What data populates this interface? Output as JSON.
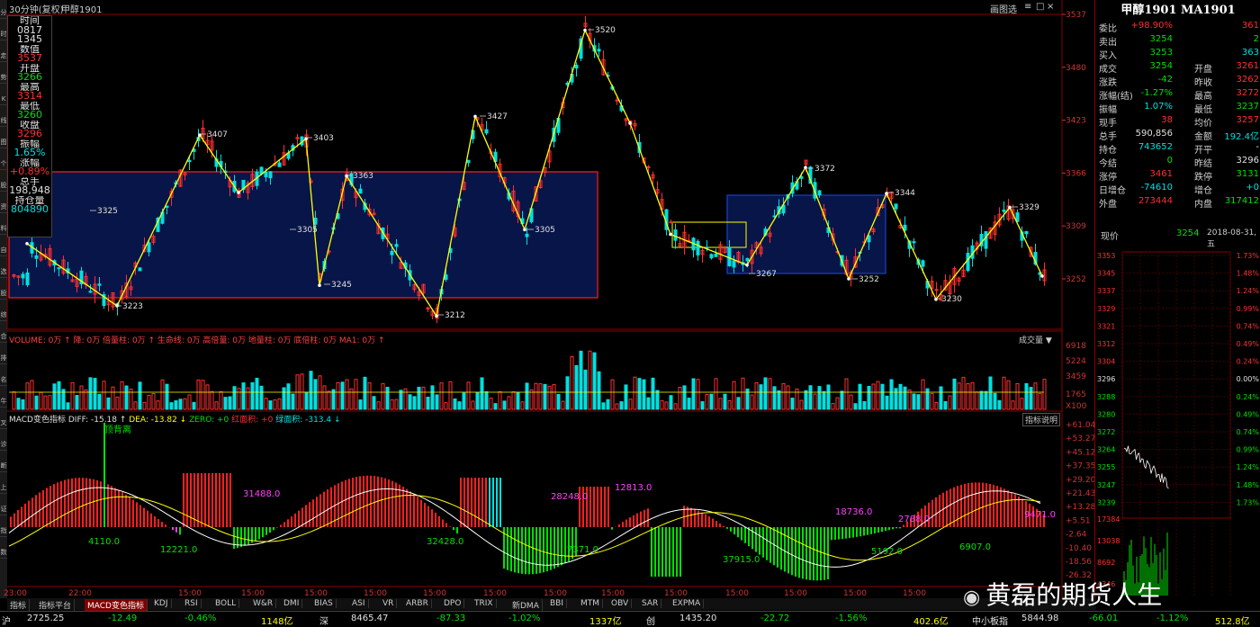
{
  "titlebar": {
    "period": "30分钟(复权)",
    "symbol": "甲醇1901",
    "btn_chart": "画图选",
    "btn_menu": "≡",
    "btn_min": "□",
    "btn_close": "×"
  },
  "leftstrip": [
    "分",
    "时",
    "走",
    "势",
    "K",
    "线",
    "图",
    "个",
    "股",
    "资",
    "料",
    "自",
    "选",
    "股",
    "综",
    "合",
    "排",
    "名",
    "牛",
    "叉",
    "诊",
    "断",
    "上",
    "证",
    "指",
    "数"
  ],
  "infobox": {
    "time_label": "时间",
    "time_value": "0817",
    "time_value2": "1345",
    "num_label": "数值",
    "num_value": "3537",
    "open_label": "开盘",
    "open_value": "3266",
    "high_label": "最高",
    "high_value": "3314",
    "low_label": "最低",
    "low_value": "3260",
    "close_label": "收盘",
    "close_value": "3296",
    "amp_label": "振幅",
    "amp_value": "1.65%",
    "chg_label": "涨幅",
    "chg_value": "+0.89%",
    "vol_label": "总手",
    "vol_value": "198,948",
    "oi_label": "持仓量",
    "oi_value": "804890"
  },
  "price_axis": [
    "3537",
    "3480",
    "3423",
    "3366",
    "3309",
    "3252"
  ],
  "volume_axis": [
    "6918",
    "5224",
    "3459",
    "1765",
    "X100"
  ],
  "macd_axis": [
    "61.04",
    "53.27",
    "45.12",
    "37.35",
    "29.20",
    "21.43",
    "13.28",
    "5.51",
    "-2.64",
    "-10.40",
    "-18.56",
    "-26.32"
  ],
  "volume_header": {
    "text": "VOLUME: 0万 ↑ 降: 0万 倍量柱: 0万 ↑ 生命线: 0万 高倍量: 0万 地量柱: 0万 底倍柱: 0万 MA1: 0万 ↑",
    "btn": "成交量 ▼"
  },
  "macd_header": {
    "name": "MACD变色指标",
    "diff": "DIFF: -15.18 ↑",
    "dea": "DEA: -13.82 ↓",
    "zero": "ZERO: +0",
    "redarea": "红面积: +0",
    "greenarea": "绿面积: -313.4 ↓",
    "btn": "指标说明"
  },
  "macd_labels": [
    {
      "text": "顶背离",
      "color": "#00e000"
    },
    {
      "text": "31488.0",
      "color": "#ff40ff"
    },
    {
      "text": "28248.0",
      "color": "#ff40ff"
    },
    {
      "text": "12813.0",
      "color": "#ff40ff"
    },
    {
      "text": "18736.0",
      "color": "#ff40ff"
    },
    {
      "text": "2788.0",
      "color": "#ff40ff"
    },
    {
      "text": "9471.0",
      "color": "#ff40ff"
    },
    {
      "text": "4110.0",
      "color": "#00e000"
    },
    {
      "text": "12221.0",
      "color": "#00e000"
    },
    {
      "text": "32428.0",
      "color": "#00e000"
    },
    {
      "text": "7371.0",
      "color": "#00e000"
    },
    {
      "text": "37915.0",
      "color": "#00e000"
    },
    {
      "text": "5192.0",
      "color": "#00e000"
    },
    {
      "text": "6907.0",
      "color": "#00e000"
    }
  ],
  "time_labels": [
    "23:00",
    "22:00",
    "15:00",
    "15:00",
    "15:00",
    "15:00",
    "15:00",
    "15:00",
    "15:00",
    "15:00",
    "15:00",
    "15:00",
    "15:00",
    "15:00",
    "15:00"
  ],
  "price_marks": [
    "3325",
    "3223",
    "3407",
    "3403",
    "3305",
    "3363",
    "3245",
    "3212",
    "3427",
    "3305",
    "3520",
    "3267",
    "3372",
    "3252",
    "3344",
    "3230",
    "3329"
  ],
  "bottom_tabs": [
    "指标",
    "指标平台",
    "MACD变色指标",
    "KDJ",
    "RSI",
    "BOLL",
    "W&R",
    "DMI",
    "BIAS",
    "ASI",
    "VR",
    "ARBR",
    "DPO",
    "TRIX",
    "新DMA",
    "BBI",
    "MTM",
    "OBV",
    "SAR",
    "EXPMA"
  ],
  "statusbar": {
    "sh": "沪",
    "sh_value": "2725.25",
    "sh_chg": "-12.49",
    "sh_pct": "-0.46%",
    "sh_amt": "1148亿",
    "sz": "深",
    "sz_value": "8465.47",
    "sz_chg": "-87.33",
    "sz_pct": "-1.02%",
    "sz_amt": "1337亿",
    "cy": "创",
    "cy_value": "1435.20",
    "cy_chg": "-22.72",
    "cy_pct": "-1.56%",
    "cy_amt": "402.6亿",
    "zx": "中小板指",
    "zx_value": "5844.98",
    "zx_chg": "-66.01",
    "zx_pct": "-1.12%",
    "zx_amt": "512.8亿"
  },
  "rightpanel": {
    "title": "甲醇1901 MA1901",
    "rows": [
      {
        "l": "委比",
        "v": "+98.90%",
        "vc": "#ff3030",
        "l2": "",
        "v2": "361",
        "v2c": "#ff3030"
      },
      {
        "l": "卖出",
        "v": "3254",
        "vc": "#00e000",
        "l2": "",
        "v2": "2",
        "v2c": "#00e000"
      },
      {
        "l": "买入",
        "v": "3253",
        "vc": "#00e000",
        "l2": "",
        "v2": "363",
        "v2c": "#00e0e0"
      },
      {
        "l": "成交",
        "v": "3254",
        "vc": "#00e000",
        "l2": "开盘",
        "v2": "3261",
        "v2c": "#ff3030"
      },
      {
        "l": "涨跌",
        "v": "-42",
        "vc": "#00e000",
        "l2": "昨收",
        "v2": "3262",
        "v2c": "#ff3030"
      },
      {
        "l": "涨幅(结)",
        "v": "-1.27%",
        "vc": "#00e000",
        "l2": "最高",
        "v2": "3272",
        "v2c": "#ff3030"
      },
      {
        "l": "振幅",
        "v": "1.07%",
        "vc": "#00e0e0",
        "l2": "最低",
        "v2": "3237",
        "v2c": "#00e000"
      },
      {
        "l": "现手",
        "v": "38",
        "vc": "#ff3030",
        "l2": "均价",
        "v2": "3257",
        "v2c": "#ff3030"
      },
      {
        "l": "总手",
        "v": "590,856",
        "vc": "#e0e0e0",
        "l2": "金额",
        "v2": "192.4亿",
        "v2c": "#00e0e0"
      },
      {
        "l": "持仓",
        "v": "743652",
        "vc": "#00e0e0",
        "l2": "开平",
        "v2": "-",
        "v2c": "#e0e0e0"
      },
      {
        "l": "今结",
        "v": "0",
        "vc": "#00e000",
        "l2": "昨结",
        "v2": "3296",
        "v2c": "#e0e0e0"
      },
      {
        "l": "涨停",
        "v": "3461",
        "vc": "#ff3030",
        "l2": "跌停",
        "v2": "3131",
        "v2c": "#00e000"
      },
      {
        "l": "日增仓",
        "v": "-74610",
        "vc": "#00e0e0",
        "l2": "增仓",
        "v2": "+0",
        "v2c": "#00e0e0"
      },
      {
        "l": "外盘",
        "v": "273444",
        "vc": "#ff3030",
        "l2": "内盘",
        "v2": "317412",
        "v2c": "#00e000"
      }
    ],
    "now_label": "现价",
    "now_value": "3254",
    "date": "2018-08-31,五",
    "mini_left": [
      "3353",
      "3345",
      "3337",
      "3329",
      "3321",
      "3312",
      "3304",
      "3296",
      "3288",
      "3280",
      "3272",
      "3264",
      "3255",
      "3247",
      "3239"
    ],
    "mini_right": [
      "1.73%",
      "1.48%",
      "1.24%",
      "0.99%",
      "0.74%",
      "0.49%",
      "0.24%",
      "0.00%",
      "0.24%",
      "0.49%",
      "0.74%",
      "0.99%",
      "1.24%",
      "1.48%",
      "1.73%"
    ],
    "mini_vol": [
      "17384",
      "13038",
      "8692",
      "4346"
    ]
  },
  "watermark": "黄磊的期货人生",
  "colors": {
    "up": "#ff3030",
    "down": "#00e0e0",
    "zigzag": "#ffff00",
    "box_red": "#ff2020",
    "box_blue": "#1a3fd0",
    "box_fill": "#0a1a4a"
  }
}
